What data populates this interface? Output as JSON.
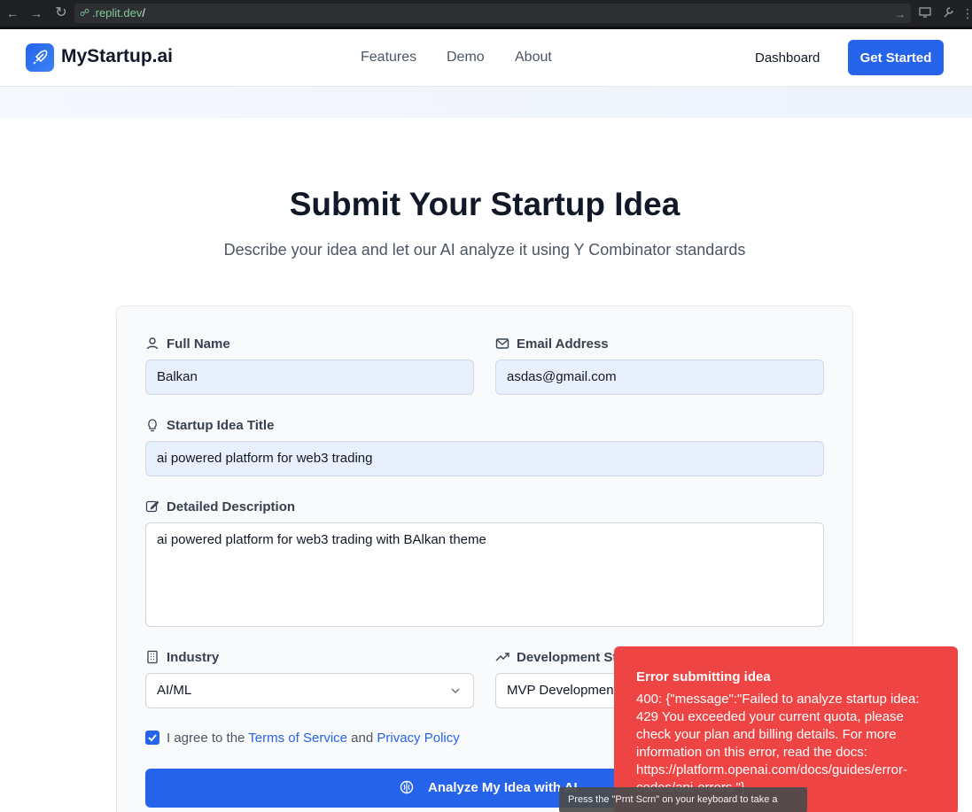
{
  "browser": {
    "url_host": ".replit.dev",
    "url_path": "/"
  },
  "header": {
    "brand": "MyStartup.ai",
    "nav": [
      "Features",
      "Demo",
      "About"
    ],
    "dashboard_label": "Dashboard",
    "get_started_label": "Get Started"
  },
  "hero": {
    "title": "Submit Your Startup Idea",
    "subtitle": "Describe your idea and let our AI analyze it using Y Combinator standards"
  },
  "form": {
    "full_name_label": "Full Name",
    "full_name_value": "Balkan",
    "email_label": "Email Address",
    "email_value": "asdas@gmail.com",
    "idea_title_label": "Startup Idea Title",
    "idea_title_value": "ai powered platform for web3 trading",
    "description_label": "Detailed Description",
    "description_value": "ai powered platform for web3 trading with BAlkan theme",
    "industry_label": "Industry",
    "industry_value": "AI/ML",
    "stage_label": "Development Sta",
    "stage_value": "MVP Development",
    "agree_prefix": "I agree to the ",
    "terms_label": "Terms of Service",
    "agree_and": " and ",
    "privacy_label": "Privacy Policy",
    "submit_label": "Analyze My Idea with AI"
  },
  "toast": {
    "title": "Error submitting idea",
    "message": "400: {\"message\":\"Failed to analyze startup idea: 429 You exceeded your current quota, please check your plan and billing details. For more information on this error, read the docs: https://platform.openai.com/docs/guides/error-codes/api-errors.\"}"
  },
  "tooltip": {
    "text": "Press the \"Prnt Scrn\" on your keyboard to take a"
  },
  "colors": {
    "accent": "#2563eb",
    "error": "#ef4444"
  }
}
